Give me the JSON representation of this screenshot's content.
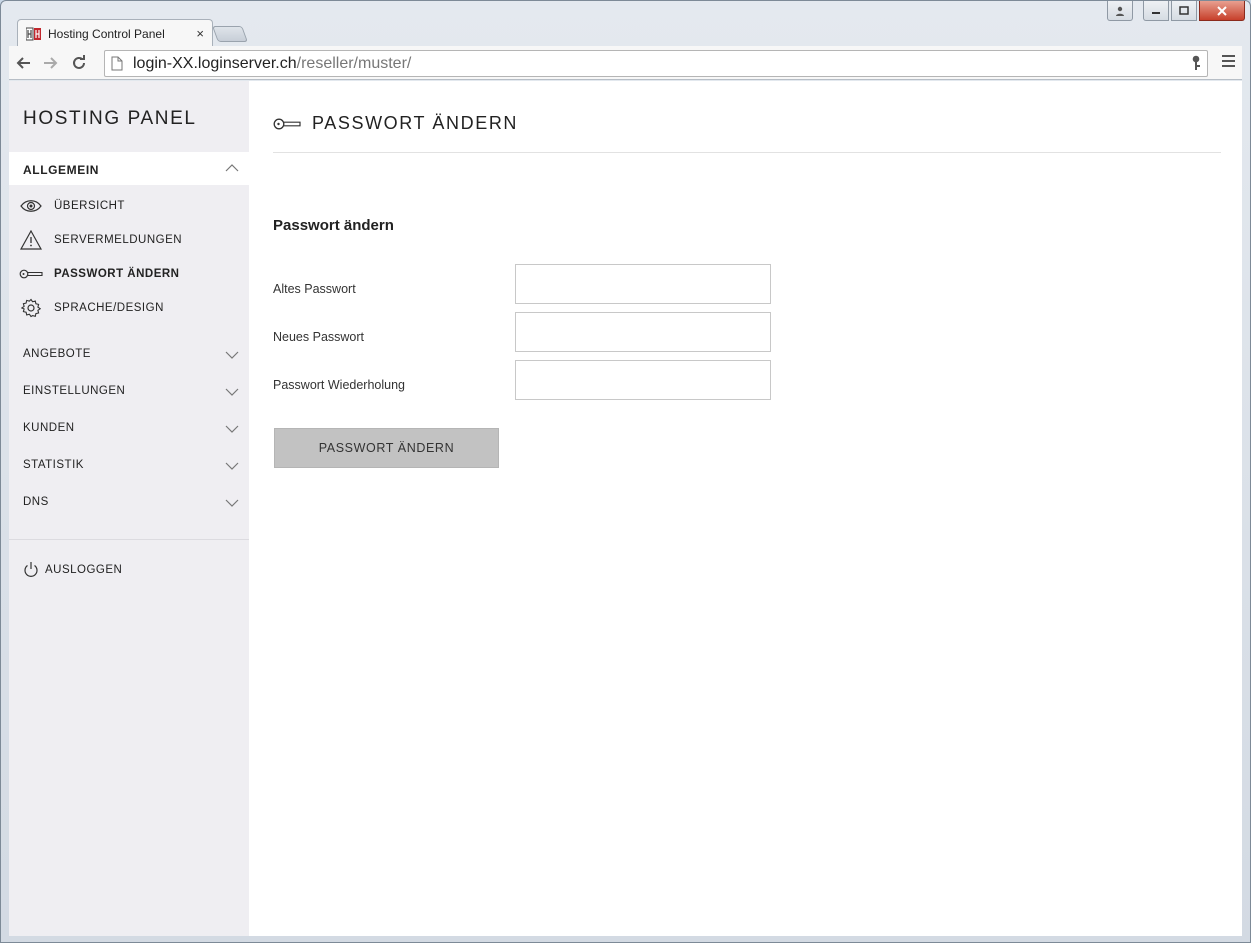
{
  "browser": {
    "tab_title": "Hosting Control Panel",
    "tab_close": "×",
    "url_host": "login-XX.loginserver.ch",
    "url_path": "/reseller/muster/"
  },
  "sidebar": {
    "brand": "HOSTING PANEL",
    "section": {
      "label": "ALLGEMEIN",
      "items": [
        {
          "label": "ÜBERSICHT",
          "icon": "eye-icon"
        },
        {
          "label": "SERVERMELDUNGEN",
          "icon": "warning-icon"
        },
        {
          "label": "PASSWORT ÄNDERN",
          "icon": "key-icon",
          "active": true
        },
        {
          "label": "SPRACHE/DESIGN",
          "icon": "gear-icon"
        }
      ]
    },
    "groups": [
      {
        "label": "ANGEBOTE"
      },
      {
        "label": "EINSTELLUNGEN"
      },
      {
        "label": "KUNDEN"
      },
      {
        "label": "STATISTIK"
      },
      {
        "label": "DNS"
      }
    ],
    "logout": "AUSLOGGEN"
  },
  "main": {
    "page_title": "PASSWORT ÄNDERN",
    "form_title": "Passwort ändern",
    "fields": [
      {
        "label": "Altes Passwort",
        "value": ""
      },
      {
        "label": "Neues Passwort",
        "value": ""
      },
      {
        "label": "Passwort Wiederholung",
        "value": ""
      }
    ],
    "submit_label": "PASSWORT ÄNDERN"
  }
}
